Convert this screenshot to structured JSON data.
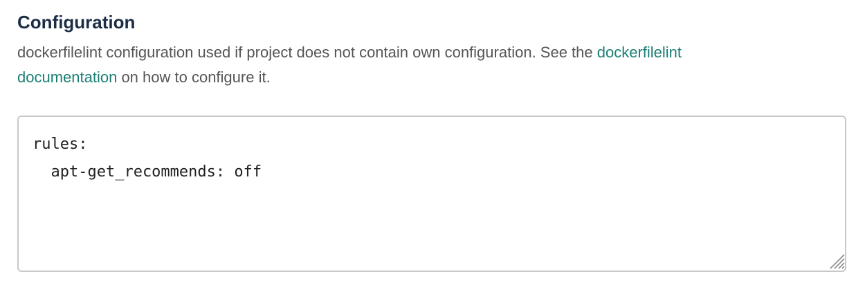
{
  "section": {
    "title": "Configuration",
    "description_prefix": "dockerfilelint configuration used if project does not contain own configuration. See the ",
    "link_text": "dockerfilelint documentation",
    "description_suffix": " on how to configure it."
  },
  "config_editor": {
    "value": "rules:\n  apt-get_recommends: off"
  },
  "icons": {
    "resize": "resize-handle-icon"
  },
  "colors": {
    "title": "#1b2d45",
    "text": "#555555",
    "link": "#1a7f74",
    "border": "#c8c8c8"
  }
}
